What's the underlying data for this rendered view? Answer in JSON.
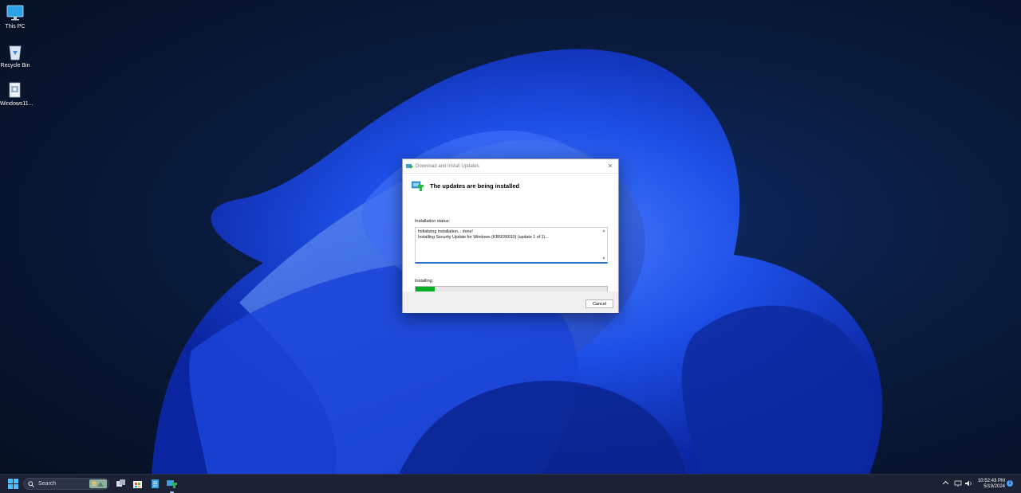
{
  "desktop": {
    "icons": [
      {
        "label": "This PC",
        "icon": "monitor-icon"
      },
      {
        "label": "Recycle Bin",
        "icon": "recycle-bin-icon"
      },
      {
        "label": "Windows11...",
        "icon": "installer-icon"
      }
    ]
  },
  "dialog": {
    "title": "Download and Install Updates",
    "heading": "The updates are being installed",
    "status_label": "Installation status:",
    "status_lines": [
      "Initializing installation... done!",
      "Installing Security Update for Windows (KB5036910) (update 1 of 1)..."
    ],
    "progress_label": "Installing:",
    "progress": 0.1,
    "cancel_label": "Cancel",
    "close_icon": "close-icon"
  },
  "taskbar": {
    "search_placeholder": "Search",
    "time": "10:52:43 PM",
    "date": "5/19/2024",
    "notification_count": "1"
  },
  "colors": {
    "progress_fill": "#06b025",
    "accent": "#2b73c9"
  }
}
